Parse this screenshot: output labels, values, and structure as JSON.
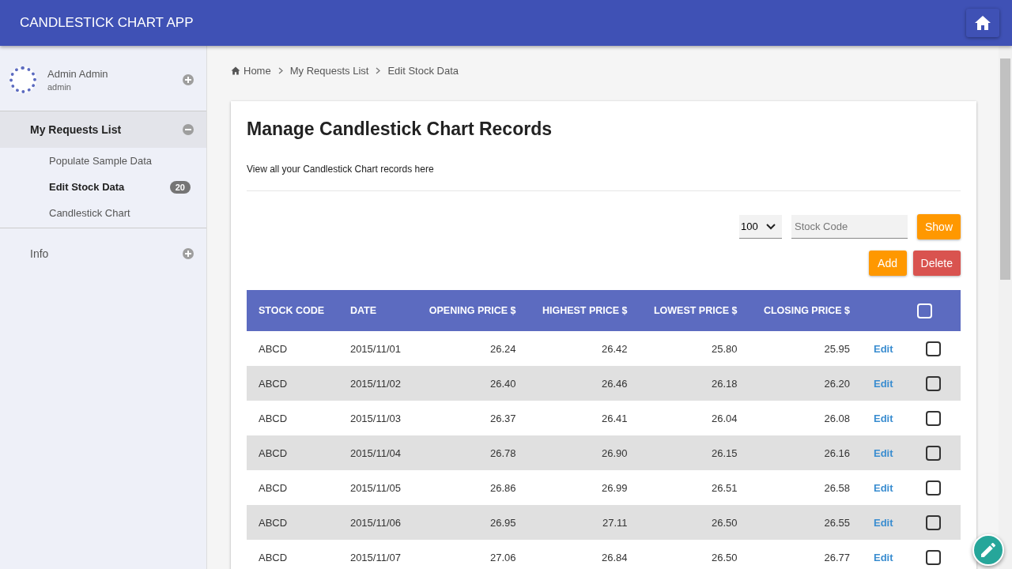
{
  "app_bar": {
    "title": "CANDLESTICK CHART APP"
  },
  "sidebar": {
    "user": {
      "name": "Admin Admin",
      "role": "admin",
      "expanded": false
    },
    "menu": [
      {
        "label": "My Requests List",
        "expanded": true,
        "children": [
          {
            "label": "Populate Sample Data",
            "selected": false
          },
          {
            "label": "Edit Stock Data",
            "selected": true,
            "badge": "20"
          },
          {
            "label": "Candlestick Chart",
            "selected": false
          }
        ]
      },
      {
        "label": "Info",
        "expanded": false
      }
    ]
  },
  "breadcrumb": [
    {
      "label": "Home",
      "kind": "home"
    },
    {
      "label": "My Requests List",
      "kind": "link"
    },
    {
      "label": "Edit Stock Data",
      "kind": "current"
    }
  ],
  "card": {
    "title": "Manage Candlestick Chart Records",
    "subtitle": "View all your Candlestick Chart records here"
  },
  "filters": {
    "page_size": "100",
    "stock_code": {
      "placeholder": "Stock Code"
    }
  },
  "search_buttons": [
    {
      "label": "Show",
      "kind": "primary"
    }
  ],
  "record_buttons": [
    {
      "label": "Add",
      "kind": "primary"
    },
    {
      "label": "Delete",
      "kind": "danger"
    }
  ],
  "table": {
    "columns": [
      "STOCK CODE",
      "DATE",
      "OPENING PRICE $",
      "HIGHEST PRICE $",
      "LOWEST PRICE $",
      "CLOSING PRICE $"
    ],
    "select_all": {
      "checked": false
    },
    "rows": [
      {
        "cells": [
          "ABCD",
          "2015/11/01",
          "26.24",
          "26.42",
          "25.80",
          "25.95"
        ],
        "action": "Edit",
        "checked": false
      },
      {
        "cells": [
          "ABCD",
          "2015/11/02",
          "26.40",
          "26.46",
          "26.18",
          "26.20"
        ],
        "action": "Edit",
        "checked": false
      },
      {
        "cells": [
          "ABCD",
          "2015/11/03",
          "26.37",
          "26.41",
          "26.04",
          "26.08"
        ],
        "action": "Edit",
        "checked": false
      },
      {
        "cells": [
          "ABCD",
          "2015/11/04",
          "26.78",
          "26.90",
          "26.15",
          "26.16"
        ],
        "action": "Edit",
        "checked": false
      },
      {
        "cells": [
          "ABCD",
          "2015/11/05",
          "26.86",
          "26.99",
          "26.51",
          "26.58"
        ],
        "action": "Edit",
        "checked": false
      },
      {
        "cells": [
          "ABCD",
          "2015/11/06",
          "26.95",
          "27.11",
          "26.50",
          "26.55"
        ],
        "action": "Edit",
        "checked": false
      },
      {
        "cells": [
          "ABCD",
          "2015/11/07",
          "27.06",
          "26.84",
          "26.50",
          "26.77"
        ],
        "action": "Edit",
        "checked": false
      }
    ]
  }
}
